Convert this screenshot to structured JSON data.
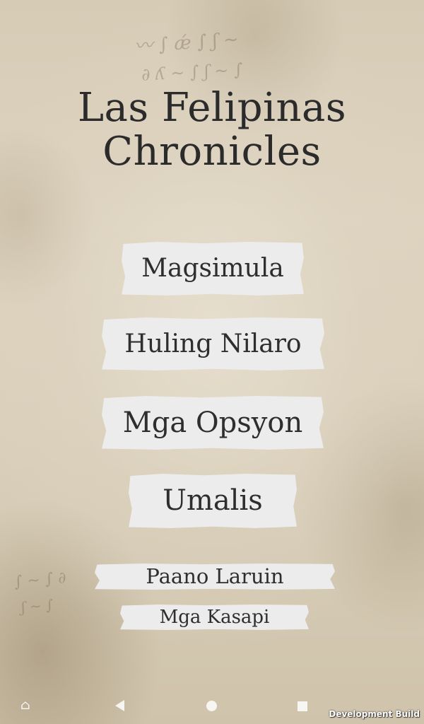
{
  "game": {
    "title_line1": "Las Felipinas",
    "title_line2": "Chronicles"
  },
  "menu": {
    "start_label": "Magsimula",
    "continue_label": "Huling Nilaro",
    "options_label": "Mga Opsyon",
    "quit_label": "Umalis",
    "how_to_play_label": "Paano Laruin",
    "credits_label": "Mga Kasapi"
  },
  "system": {
    "build_label": "Development Build",
    "nav_icons": [
      "home-icon",
      "back-icon",
      "home-circle-icon",
      "recents-icon"
    ]
  },
  "colors": {
    "parchment": "#d8cdb8",
    "button_paper": "#ececec",
    "text": "#2b2b2b"
  }
}
